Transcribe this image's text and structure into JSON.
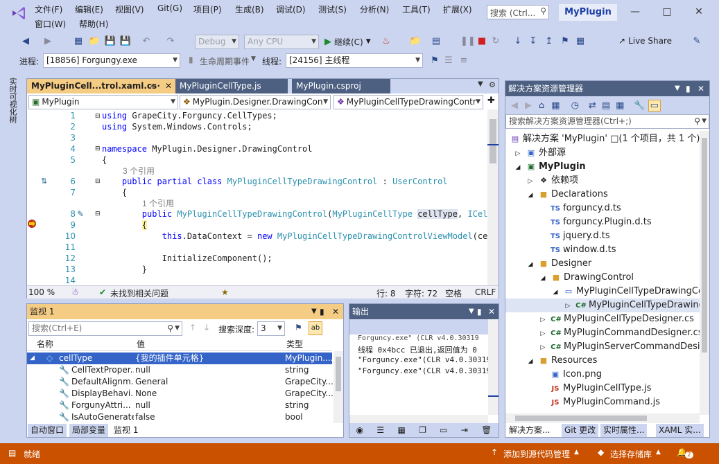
{
  "menu": {
    "file": "文件(F)",
    "edit": "编辑(E)",
    "view": "视图(V)",
    "git": "Git(G)",
    "project": "项目(P)",
    "build": "生成(B)",
    "debug": "调试(D)",
    "test": "测试(S)",
    "analyze": "分析(N)",
    "tools": "工具(T)",
    "extensions": "扩展(X)",
    "window": "窗口(W)",
    "help": "帮助(H)"
  },
  "search": {
    "placeholder": "搜索 (Ctrl..."
  },
  "title": "MyPlugin",
  "toolbar": {
    "config": "Debug",
    "platform": "Any CPU",
    "continue": "继续(C)",
    "live_share": "Live Share"
  },
  "debugbar": {
    "process_label": "进程:",
    "process": "[18856] Forgungy.exe",
    "lifecycle": "生命周期事件",
    "thread_label": "线程:",
    "thread": "[24156] 主线程"
  },
  "leftstrip": {
    "vertical_tab": "实时可视化树"
  },
  "editor": {
    "tabs": [
      "MyPluginCell...trol.xaml.cs",
      "MyPluginCellType.js",
      "MyPlugin.csproj"
    ],
    "nav": {
      "project": "MyPlugin",
      "namespace": "MyPlugin.Designer.DrawingCon",
      "member": "MyPluginCellTypeDrawingContr"
    },
    "line_numbers": [
      "1",
      "2",
      "3",
      "4",
      "5",
      "6",
      "7",
      "8",
      "9",
      "10",
      "11",
      "12",
      "13",
      "14"
    ],
    "codelens": [
      "3 个引用",
      "1 个引用"
    ],
    "zoom": "100 %",
    "issues": "未找到相关问题",
    "line": "行: 8",
    "col": "字符: 72",
    "space": "空格",
    "eol": "CRLF"
  },
  "watch": {
    "title": "监视 1",
    "search_placeholder": "搜索(Ctrl+E)",
    "depth_label": "搜索深度:",
    "depth": "3",
    "headers": [
      "名称",
      "值",
      "类型"
    ],
    "rows": [
      {
        "name": "cellType",
        "value": "{我的插件单元格}",
        "type": "MyPlugin...."
      },
      {
        "name": "CellTextProper...",
        "value": "null",
        "type": "string"
      },
      {
        "name": "DefaultAlignm...",
        "value": "General",
        "type": "GrapeCity...."
      },
      {
        "name": "DisplayBehavi...",
        "value": "None",
        "type": "GrapeCity...."
      },
      {
        "name": "ForgunyAttri...",
        "value": "null",
        "type": "string"
      },
      {
        "name": "IsAutoGenerated",
        "value": "false",
        "type": "bool"
      }
    ],
    "bottom_tabs": [
      "自动窗口",
      "局部变量",
      "监视 1"
    ]
  },
  "output": {
    "title": "输出",
    "lines": [
      "Forguncy.exe\" (CLR v4.0.30319",
      "线程 0x4bcc 已退出,返回值为 0",
      "\"Forguncy.exe\"(CLR v4.0.30319",
      "\"Forguncy.exe\"(CLR v4.0.30319"
    ]
  },
  "solution": {
    "title": "解决方案资源管理器",
    "search_placeholder": "搜索解决方案资源管理器(Ctrl+;)",
    "items": [
      {
        "label": "解决方案 'MyPlugin' □(1 个项目，共 1 个)",
        "icon": "solution-icon"
      },
      {
        "label": "外部源",
        "icon": "external-icon"
      },
      {
        "label": "MyPlugin",
        "icon": "csproj-icon"
      },
      {
        "label": "依赖项",
        "icon": "dependencies-icon"
      },
      {
        "label": "Declarations",
        "icon": "folder-icon"
      },
      {
        "label": "forguncy.d.ts",
        "icon": "ts-icon"
      },
      {
        "label": "forguncy.Plugin.d.ts",
        "icon": "ts-icon"
      },
      {
        "label": "jquery.d.ts",
        "icon": "ts-icon"
      },
      {
        "label": "window.d.ts",
        "icon": "ts-icon"
      },
      {
        "label": "Designer",
        "icon": "folder-icon"
      },
      {
        "label": "DrawingControl",
        "icon": "folder-icon"
      },
      {
        "label": "MyPluginCellTypeDrawingCon",
        "icon": "xaml-icon"
      },
      {
        "label": "MyPluginCellTypeDrawingC",
        "icon": "cs-icon"
      },
      {
        "label": "MyPluginCellTypeDesigner.cs",
        "icon": "cs-icon"
      },
      {
        "label": "MyPluginCommandDesigner.cs",
        "icon": "cs-icon"
      },
      {
        "label": "MyPluginServerCommandDesign",
        "icon": "cs-icon"
      },
      {
        "label": "Resources",
        "icon": "folder-icon"
      },
      {
        "label": "Icon.png",
        "icon": "image-icon"
      },
      {
        "label": "MyPluginCellType.js",
        "icon": "js-icon"
      },
      {
        "label": "MyPluginCommand.js",
        "icon": "js-icon"
      }
    ],
    "bottom_tabs": [
      "解决方案...",
      "Git 更改",
      "实时属性...",
      "XAML 实..."
    ]
  },
  "statusbar": {
    "ready": "就绪",
    "add_source": "添加到源代码管理",
    "select_repo": "选择存储库",
    "notifications": "2"
  }
}
